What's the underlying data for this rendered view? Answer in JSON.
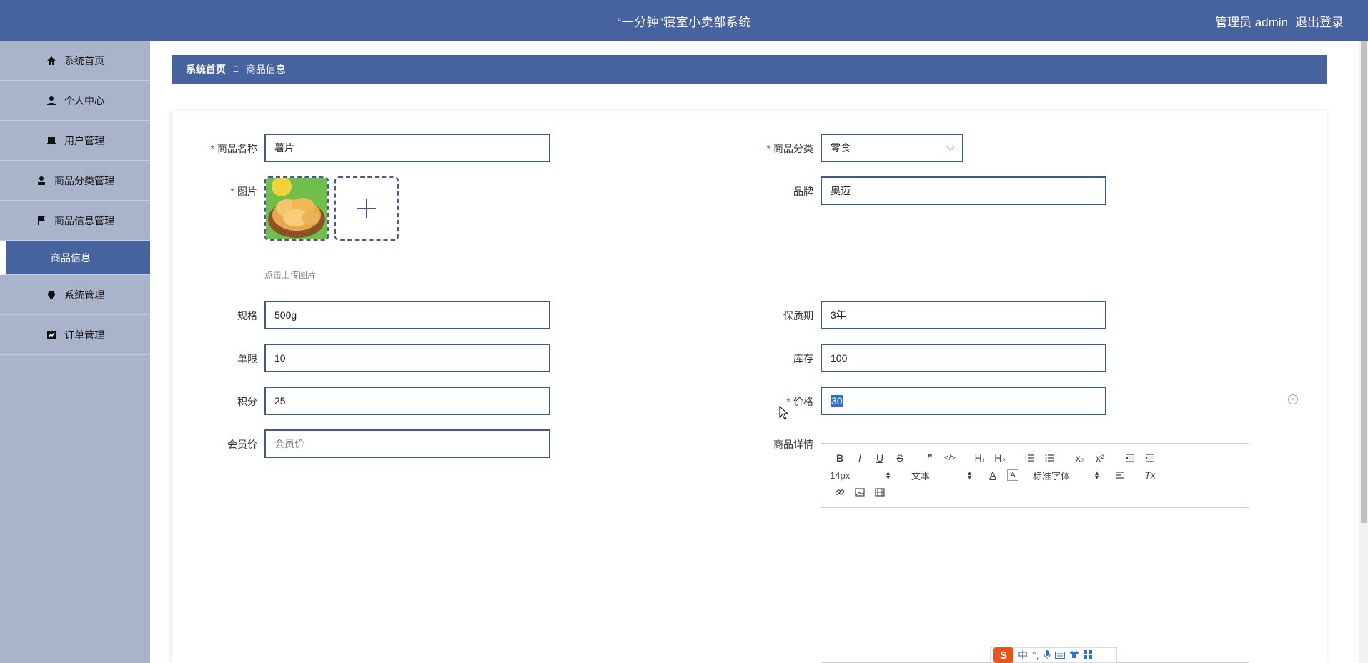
{
  "header": {
    "title": "“一分钟”寝室小卖部系统",
    "user_label": "管理员 admin",
    "logout_label": "退出登录"
  },
  "sidebar": {
    "items": [
      {
        "label": "系统首页",
        "icon": "home-icon"
      },
      {
        "label": "个人中心",
        "icon": "user-icon"
      },
      {
        "label": "用户管理",
        "icon": "inbox-icon"
      },
      {
        "label": "商品分类管理",
        "icon": "person-icon"
      },
      {
        "label": "商品信息管理",
        "icon": "flag-icon"
      },
      {
        "label": "商品信息",
        "icon": ""
      },
      {
        "label": "系统管理",
        "icon": "bulb-icon"
      },
      {
        "label": "订单管理",
        "icon": "chart-icon"
      }
    ]
  },
  "breadcrumb": {
    "home": "系统首页",
    "separator": "Ξ",
    "current": "商品信息"
  },
  "form": {
    "product_name_label": "商品名称",
    "product_name_value": "薯片",
    "category_label": "商品分类",
    "category_value": "零食",
    "image_label": "图片",
    "upload_hint": "点击上传图片",
    "brand_label": "品牌",
    "brand_value": "奥迈",
    "spec_label": "规格",
    "spec_value": "500g",
    "shelf_life_label": "保质期",
    "shelf_life_value": "3年",
    "limit_label": "单限",
    "limit_value": "10",
    "stock_label": "库存",
    "stock_value": "100",
    "points_label": "积分",
    "points_value": "25",
    "price_label": "价格",
    "price_value": "30",
    "member_price_label": "会员价",
    "member_price_placeholder": "会员价",
    "details_label": "商品详情",
    "required_mark": "*"
  },
  "editor": {
    "font_size": "14px",
    "paragraph": "文本",
    "font_family": "标准字体",
    "bold": "B",
    "italic": "I",
    "underline": "U",
    "strike": "S",
    "h1": "H₁",
    "h2": "H₂",
    "sub": "x₂",
    "sup": "x²",
    "clean": "Tx"
  },
  "ime": {
    "logo": "S",
    "lang": "中"
  },
  "colors": {
    "primary": "#4663a0",
    "sidebar": "#a9b3c9",
    "required": "#e04040",
    "selection": "#2f6fd6"
  }
}
